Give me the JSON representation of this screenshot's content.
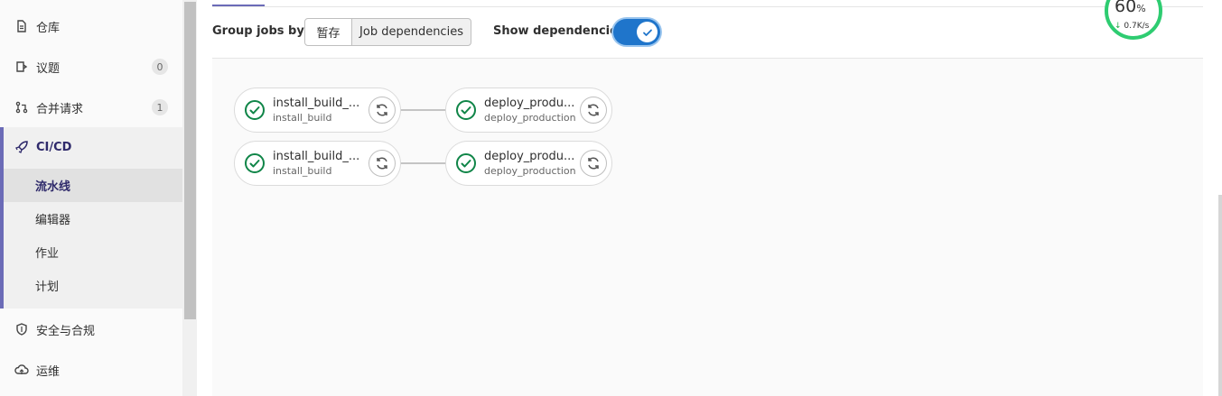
{
  "sidebar": {
    "items": [
      {
        "label": "仓库",
        "icon": "document-icon"
      },
      {
        "label": "议题",
        "icon": "issues-icon",
        "badge": "0"
      },
      {
        "label": "合并请求",
        "icon": "merge-request-icon",
        "badge": "1"
      }
    ],
    "cicd": {
      "label": "CI/CD",
      "icon": "rocket-icon",
      "subitems": [
        "流水线",
        "编辑器",
        "作业",
        "计划"
      ],
      "active": "流水线"
    },
    "bottom_items": [
      {
        "label": "安全与合规",
        "icon": "shield-icon"
      },
      {
        "label": "运维",
        "icon": "cloud-icon"
      }
    ]
  },
  "toolbar": {
    "group_label": "Group jobs by",
    "stage_option": "暂存",
    "deps_option": "Job dependencies",
    "selected_option": "Job dependencies",
    "show_deps_label": "Show dependencies",
    "show_deps_enabled": true
  },
  "pipeline": {
    "rows": [
      {
        "jobs": [
          {
            "name": "install_build_...",
            "stage": "install_build",
            "status": "passed"
          },
          {
            "name": "deploy_produ...",
            "stage": "deploy_production",
            "status": "passed"
          }
        ]
      },
      {
        "jobs": [
          {
            "name": "install_build_...",
            "stage": "install_build",
            "status": "passed"
          },
          {
            "name": "deploy_produ...",
            "stage": "deploy_production",
            "status": "passed"
          }
        ]
      }
    ]
  },
  "network_widget": {
    "percent": "60",
    "percent_unit": "%",
    "speed": "0.7K/s",
    "direction": "down"
  },
  "colors": {
    "accent": "#6b6bb7",
    "toggle": "#1f75cb",
    "success": "#108548",
    "gauge": "#2ecc71"
  }
}
